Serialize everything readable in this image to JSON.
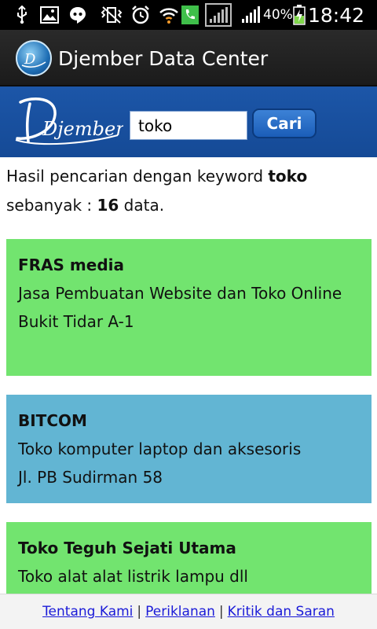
{
  "status_bar": {
    "icons": [
      "usb-icon",
      "image-icon",
      "chat-icon",
      "vibrate-icon",
      "alarm-icon",
      "wifi-icon",
      "call-icon",
      "signal-outline-icon",
      "signal-icon",
      "battery-charging-icon"
    ],
    "battery": "40%",
    "time": "18:42"
  },
  "action_bar": {
    "title": "Djember Data Center"
  },
  "search": {
    "brand": "Djember",
    "value": "toko",
    "button_label": "Cari"
  },
  "summary": {
    "prefix": "Hasil pencarian dengan keyword ",
    "keyword": "toko",
    "middle": " sebanyak : ",
    "count": "16",
    "suffix": " data."
  },
  "results": [
    {
      "name": "FRAS media",
      "description": "Jasa Pembuatan Website dan Toko Online",
      "address": "Bukit Tidar A-1",
      "color": "#72e46f"
    },
    {
      "name": "BITCOM",
      "description": "Toko komputer laptop dan aksesoris",
      "address": "Jl. PB Sudirman 58",
      "color": "#62b5d3"
    },
    {
      "name": "Toko Teguh Sejati Utama",
      "description": "Toko alat alat listrik lampu dll",
      "address": "",
      "color": "#72e46f"
    }
  ],
  "footer": {
    "links": [
      "Tentang Kami",
      "Periklanan",
      "Kritik dan Saran"
    ],
    "separator": "|"
  },
  "colors": {
    "header_blue": "#1c56a8",
    "card_green": "#72e46f",
    "card_blue": "#62b5d3",
    "link_blue": "#1a1ad8"
  }
}
